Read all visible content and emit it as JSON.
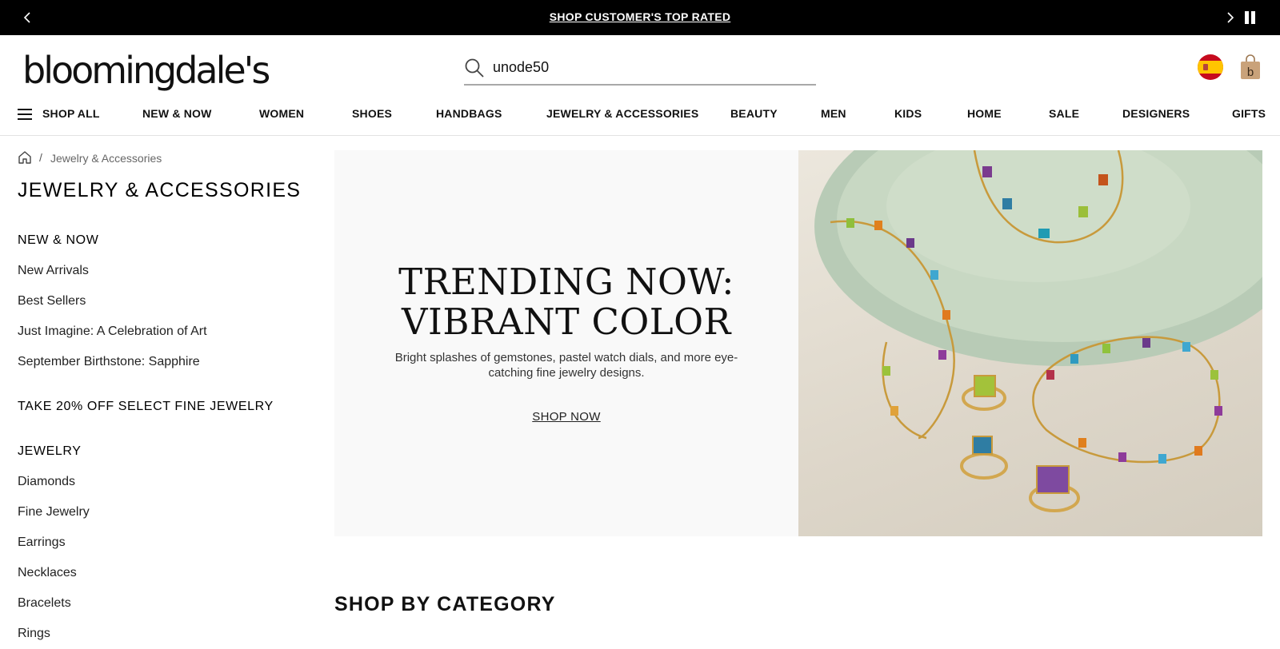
{
  "promo": {
    "text": "SHOP CUSTOMER'S TOP RATED",
    "prev_icon": "chevron-left-icon",
    "next_icon": "chevron-right-icon",
    "pause_icon": "pause-icon"
  },
  "header": {
    "logo_text": "bloomingdale's",
    "search": {
      "value": "unode50",
      "icon": "search-icon"
    },
    "flag_icon": "spain-flag-icon",
    "bag_icon": "shopping-bag-icon"
  },
  "nav": {
    "shop_all": "SHOP ALL",
    "items": [
      "NEW & NOW",
      "WOMEN",
      "SHOES",
      "HANDBAGS",
      "JEWELRY & ACCESSORIES",
      "BEAUTY",
      "MEN",
      "KIDS",
      "HOME",
      "SALE",
      "DESIGNERS",
      "GIFTS"
    ]
  },
  "breadcrumb": {
    "sep": "/",
    "current": "Jewelry & Accessories",
    "home_icon": "home-icon"
  },
  "page_title": "JEWELRY & ACCESSORIES",
  "sidebar": {
    "new_now": {
      "title": "NEW & NOW",
      "links": [
        "New Arrivals",
        "Best Sellers",
        "Just Imagine: A Celebration of Art",
        "September Birthstone: Sapphire"
      ]
    },
    "promo_title": "TAKE 20% OFF SELECT FINE JEWELRY",
    "jewelry": {
      "title": "JEWELRY",
      "links": [
        "Diamonds",
        "Fine Jewelry",
        "Earrings",
        "Necklaces",
        "Bracelets",
        "Rings"
      ]
    }
  },
  "hero": {
    "headline_1": "TRENDING NOW:",
    "headline_2": "VIBRANT COLOR",
    "subtext": "Bright splashes of gemstones, pastel watch dials, and more eye-catching fine jewelry designs.",
    "cta": "SHOP NOW"
  },
  "shop_by_category": "SHOP BY CATEGORY",
  "colors": {
    "promo_bg": "#000000",
    "accent": "#000000",
    "bag": "#c9a27a"
  }
}
